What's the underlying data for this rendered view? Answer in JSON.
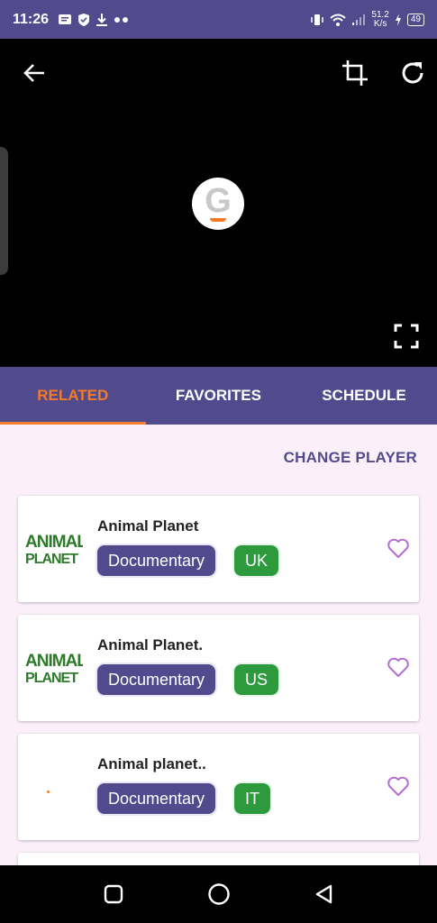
{
  "status_bar": {
    "time": "11:26",
    "net_speed_value": "51.2",
    "net_speed_unit": "K/s",
    "battery": "49"
  },
  "tabs": [
    {
      "label": "RELATED",
      "active": true
    },
    {
      "label": "FAVORITES",
      "active": false
    },
    {
      "label": "SCHEDULE",
      "active": false
    }
  ],
  "change_player_label": "CHANGE PLAYER",
  "channels": [
    {
      "title": "Animal Planet",
      "genre": "Documentary",
      "country": "UK",
      "logo": "animal-planet-logo"
    },
    {
      "title": "Animal Planet.",
      "genre": "Documentary",
      "country": "US",
      "logo": "animal-planet-logo"
    },
    {
      "title": "Animal planet..",
      "genre": "Documentary",
      "country": "IT",
      "logo": "blank-logo"
    }
  ],
  "colors": {
    "primary": "#514a8c",
    "accent": "#f47b2b",
    "country_tag": "#2e9a3e",
    "favorite": "#b46fd0",
    "logo_green": "#2d7a2a"
  }
}
